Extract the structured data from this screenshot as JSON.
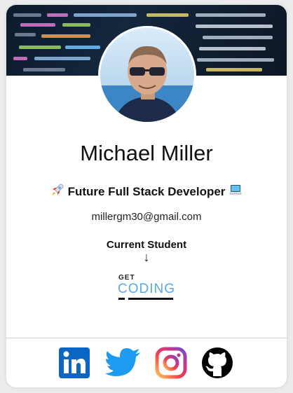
{
  "profile": {
    "name": "Michael Miller",
    "role_text": "Future Full Stack Developer",
    "role_prefix_icon": "rocket-icon",
    "role_suffix_icon": "laptop-icon",
    "email": "millergm30@gmail.com",
    "status": "Current Student",
    "arrow": "↓"
  },
  "logo": {
    "small": "GET",
    "big": "CODING",
    "color": "#5aa7e8"
  },
  "social": [
    {
      "name": "linkedin",
      "icon": "linkedin-icon",
      "color": "#0a66c2"
    },
    {
      "name": "twitter",
      "icon": "twitter-icon",
      "color": "#1d9bf0"
    },
    {
      "name": "instagram",
      "icon": "instagram-icon",
      "color": "#e1306c"
    },
    {
      "name": "github",
      "icon": "github-icon",
      "color": "#000000"
    }
  ],
  "colors": {
    "banner": "#0c1a2c",
    "card": "#ffffff",
    "background": "#ececec"
  }
}
